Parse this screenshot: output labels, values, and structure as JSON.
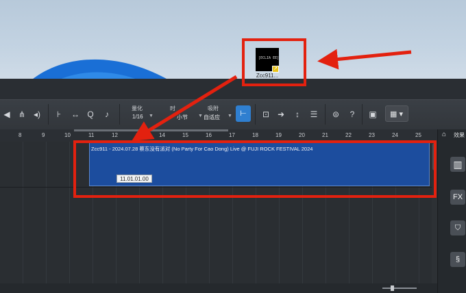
{
  "desktop": {
    "icon_logo_text": "[ECLIA EE]",
    "icon_label": "Zcc911..."
  },
  "toolbar": {
    "quantize_label": "量化",
    "quantize_value": "1/16",
    "timebase_label": "时",
    "timebase_value": "小节",
    "snap_label": "吸附",
    "snap_value": "自适应"
  },
  "ruler": {
    "bars": [
      "8",
      "9",
      "10",
      "11",
      "12",
      "13",
      "14",
      "15",
      "16",
      "17",
      "18",
      "19",
      "20",
      "21",
      "22",
      "23",
      "24",
      "25"
    ]
  },
  "clip": {
    "title": "Zcc911 - 2024.07.28 蔡东没有派对 (No Party For Cao Dong) Live @ FUJI ROCK FESTIVAL 2024"
  },
  "tooltip": {
    "position": "11.01.01.00"
  },
  "right_panel": {
    "tab_label": "效果",
    "fx_label": "FX"
  },
  "colors": {
    "annotation": "#e3210f",
    "clip": "#1c4d9e",
    "snap_active": "#2f7fd0"
  }
}
